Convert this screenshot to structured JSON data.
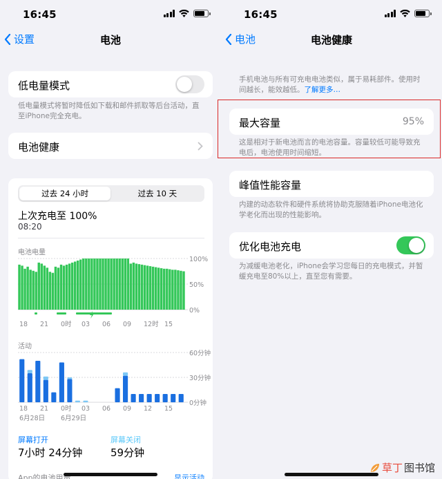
{
  "left": {
    "status": {
      "time": "16:45"
    },
    "nav": {
      "back": "设置",
      "title": "电池"
    },
    "low_power": {
      "label": "低电量模式",
      "enabled": false,
      "footnote": "低电量模式将暂时降低如下载和邮件抓取等后台活动，直至iPhone完全充电。"
    },
    "battery_health_row": {
      "label": "电池健康"
    },
    "usage": {
      "tabs": [
        "过去 24 小时",
        "过去 10 天"
      ],
      "selected_tab": "过去 24 小时",
      "last_charge_label": "上次充电至 100%",
      "last_charge_time": "08:20",
      "level_chart": {
        "title": "电池电量",
        "y_ticks": [
          "100%",
          "50%",
          "0%"
        ],
        "x_ticks": [
          "18",
          "21",
          "0时",
          "03",
          "06",
          "09",
          "12时",
          "15"
        ],
        "levels": [
          88,
          86,
          80,
          84,
          78,
          76,
          74,
          92,
          90,
          86,
          82,
          74,
          72,
          84,
          82,
          88,
          86,
          88,
          90,
          92,
          94,
          96,
          98,
          100,
          100,
          100,
          100,
          100,
          100,
          100,
          100,
          100,
          100,
          100,
          100,
          100,
          100,
          100,
          100,
          100,
          90,
          92,
          90,
          89,
          88,
          87,
          86,
          85,
          84,
          83,
          82,
          81,
          80,
          80,
          79,
          78,
          78,
          77,
          76,
          75
        ]
      },
      "activity_chart": {
        "title": "活动",
        "y_ticks": [
          "60分钟",
          "30分钟",
          "0分钟"
        ],
        "x_ticks": [
          "18",
          "21",
          "0时",
          "03",
          "06",
          "09",
          "12",
          "15"
        ],
        "date_labels": [
          "6月28日",
          "6月29日"
        ],
        "screen_on": [
          52,
          35,
          50,
          27,
          12,
          48,
          28,
          0,
          0,
          0,
          0,
          0,
          17,
          32,
          10,
          10,
          10,
          10,
          10,
          10,
          10
        ],
        "screen_off": [
          0,
          4,
          0,
          4,
          0,
          0,
          2,
          2,
          2,
          0,
          0,
          0,
          0,
          4,
          0,
          0,
          0,
          0,
          0,
          0,
          0
        ]
      },
      "screen_on": {
        "label": "屏幕打开",
        "value": "7小时 24分钟"
      },
      "screen_off": {
        "label": "屏幕关闭",
        "value": "59分钟"
      },
      "app_usage_header": "App的电池用量",
      "show_activity": "显示活动"
    }
  },
  "right": {
    "status": {
      "time": "16:45"
    },
    "nav": {
      "back": "电池",
      "title": "电池健康"
    },
    "intro": "手机电池与所有可充电电池类似，属于易耗部件。使用时间越长，能效越低。",
    "learn_more": "了解更多…",
    "max_capacity": {
      "label": "最大容量",
      "value": "95%",
      "footnote": "这是相对于新电池而言的电池容量。容量较低可能导致充电后，电池使用时间缩短。"
    },
    "peak_performance": {
      "label": "峰值性能容量",
      "footnote": "内建的动态软件和硬件系统将协助克服随着iPhone电池化学老化而出现的性能影响。"
    },
    "optimized_charging": {
      "label": "优化电池充电",
      "enabled": true,
      "footnote": "为减缓电池老化，iPhone会学习您每日的充电模式，并暂缓充电至80%以上，直至您有需要。"
    }
  },
  "watermark": {
    "part1": "草丁",
    "part2": "图书馆"
  },
  "colors": {
    "accent": "#007aff",
    "green": "#34c759",
    "screen_on": "#1a6fe0",
    "screen_off": "#7ec8f5",
    "highlight_box": "#d92626"
  }
}
